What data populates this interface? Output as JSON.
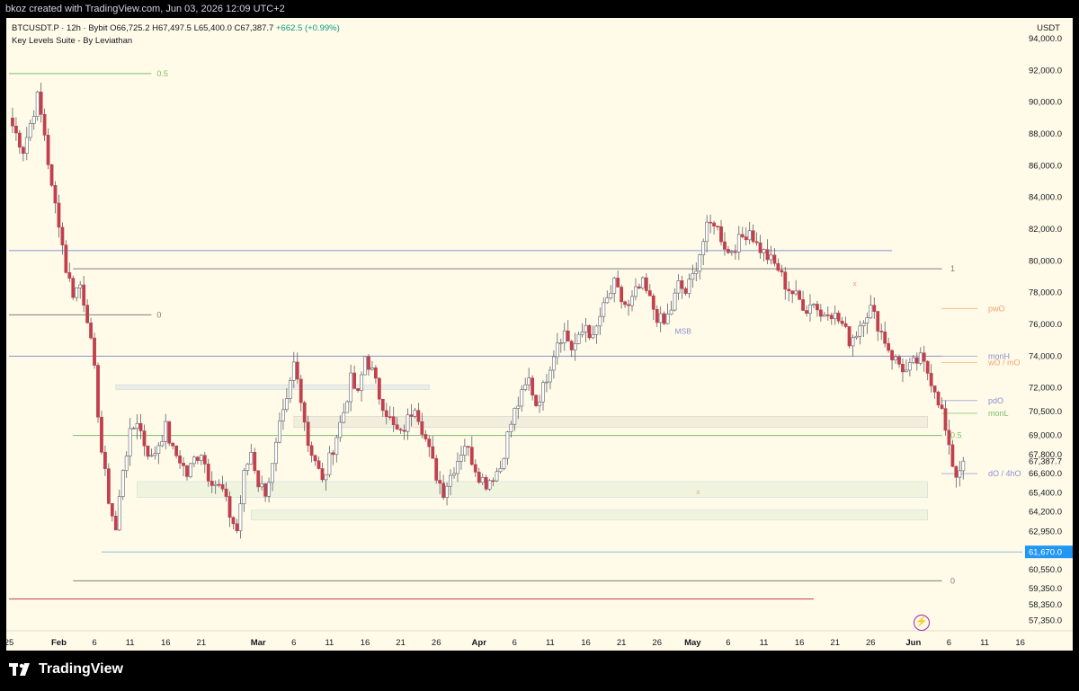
{
  "header": {
    "attribution": "bkoz created with TradingView.com, Jun 03, 2026 12:09 UTC+2"
  },
  "legend": {
    "symbol": "BTCUSDT.P · 12h · Bybit",
    "ohlc": "O66,725.2 H67,497.5 L65,400.0 C67,387.7",
    "change": "+662.5 (+0.99%)",
    "indicator": "Key Levels Suite - By Leviathan"
  },
  "brand": {
    "name": "TradingView",
    "icon": "tradingview-logo-icon"
  },
  "colors": {
    "background": "#fffbe8",
    "up": "#ffffff",
    "down": "#c2404e",
    "wick": "#5d606b",
    "blue_level": "#8c8fd6",
    "grey_level": "#7e7e7e",
    "green_level": "#7cbf6a",
    "orange_level": "#f2a272",
    "last_price_tag": "#2196f3"
  },
  "chart_data": {
    "type": "candlestick",
    "symbol": "BTCUSDT.P",
    "timeframe": "12h",
    "exchange": "Bybit",
    "ylabel": "USDT",
    "ylim": [
      56650,
      95000
    ],
    "price_ticks": [
      "94,000.0",
      "92,000.0",
      "90,000.0",
      "88,000.0",
      "86,000.0",
      "84,000.0",
      "82,000.0",
      "80,000.0",
      "78,000.0",
      "76,000.0",
      "74,000.0",
      "72,000.0",
      "70,500.0",
      "69,000.0",
      "67,800.0",
      "66,600.0",
      "65,400.0",
      "64,200.0",
      "62,950.0",
      "60,550.0",
      "59,350.0",
      "58,350.0",
      "57,350.0"
    ],
    "price_labels": [
      {
        "label": "67,387.7",
        "value": 67387.7,
        "kind": "current"
      },
      {
        "label": "61,670.0",
        "value": 61670,
        "kind": "highlight"
      }
    ],
    "x_ticks": [
      {
        "label": "25",
        "day": 0
      },
      {
        "label": "Feb",
        "day": 7,
        "bold": true
      },
      {
        "label": "6",
        "day": 12
      },
      {
        "label": "11",
        "day": 17
      },
      {
        "label": "16",
        "day": 22
      },
      {
        "label": "21",
        "day": 27
      },
      {
        "label": "Mar",
        "day": 35,
        "bold": true
      },
      {
        "label": "6",
        "day": 40
      },
      {
        "label": "11",
        "day": 45
      },
      {
        "label": "16",
        "day": 50
      },
      {
        "label": "21",
        "day": 55
      },
      {
        "label": "26",
        "day": 60
      },
      {
        "label": "Apr",
        "day": 66,
        "bold": true
      },
      {
        "label": "6",
        "day": 71
      },
      {
        "label": "11",
        "day": 76
      },
      {
        "label": "16",
        "day": 81
      },
      {
        "label": "21",
        "day": 86
      },
      {
        "label": "26",
        "day": 91
      },
      {
        "label": "May",
        "day": 96,
        "bold": true
      },
      {
        "label": "6",
        "day": 101
      },
      {
        "label": "11",
        "day": 106
      },
      {
        "label": "16",
        "day": 111
      },
      {
        "label": "21",
        "day": 116
      },
      {
        "label": "26",
        "day": 121
      },
      {
        "label": "Jun",
        "day": 127,
        "bold": true
      },
      {
        "label": "6",
        "day": 132
      },
      {
        "label": "11",
        "day": 137
      },
      {
        "label": "16",
        "day": 142
      }
    ],
    "candle_path": [
      [
        0,
        89000
      ],
      [
        2,
        87000
      ],
      [
        4,
        90300
      ],
      [
        5,
        88000
      ],
      [
        6,
        84500
      ],
      [
        7,
        82500
      ],
      [
        8,
        79500
      ],
      [
        9,
        78000
      ],
      [
        10,
        78500
      ],
      [
        11,
        76500
      ],
      [
        12,
        73000
      ],
      [
        13,
        68000
      ],
      [
        14,
        65000
      ],
      [
        15,
        63000
      ],
      [
        16,
        67000
      ],
      [
        17,
        69000
      ],
      [
        18,
        70000
      ],
      [
        19,
        68500
      ],
      [
        20,
        67500
      ],
      [
        21,
        68500
      ],
      [
        22,
        69500
      ],
      [
        23,
        68000
      ],
      [
        24,
        67500
      ],
      [
        25,
        66500
      ],
      [
        26,
        67500
      ],
      [
        27,
        68000
      ],
      [
        28,
        66500
      ],
      [
        30,
        65500
      ],
      [
        31,
        64000
      ],
      [
        32,
        63000
      ],
      [
        33,
        66500
      ],
      [
        34,
        68000
      ],
      [
        35,
        66000
      ],
      [
        36,
        65500
      ],
      [
        37,
        67000
      ],
      [
        38,
        69500
      ],
      [
        39,
        71000
      ],
      [
        40,
        73500
      ],
      [
        41,
        71500
      ],
      [
        42,
        68500
      ],
      [
        43,
        67500
      ],
      [
        44,
        66000
      ],
      [
        45,
        67500
      ],
      [
        46,
        69000
      ],
      [
        47,
        70500
      ],
      [
        48,
        72500
      ],
      [
        49,
        71500
      ],
      [
        50,
        74000
      ],
      [
        51,
        73000
      ],
      [
        52,
        71500
      ],
      [
        53,
        70500
      ],
      [
        54,
        69500
      ],
      [
        55,
        69000
      ],
      [
        56,
        70000
      ],
      [
        57,
        71000
      ],
      [
        58,
        69500
      ],
      [
        59,
        68000
      ],
      [
        60,
        66500
      ],
      [
        61,
        65500
      ],
      [
        62,
        66500
      ],
      [
        63,
        67500
      ],
      [
        64,
        68500
      ],
      [
        65,
        67500
      ],
      [
        66,
        66500
      ],
      [
        67,
        66000
      ],
      [
        68,
        66500
      ],
      [
        69,
        67000
      ],
      [
        70,
        69000
      ],
      [
        71,
        70500
      ],
      [
        72,
        71500
      ],
      [
        73,
        72500
      ],
      [
        74,
        71000
      ],
      [
        75,
        72000
      ],
      [
        76,
        73500
      ],
      [
        77,
        75000
      ],
      [
        78,
        75500
      ],
      [
        79,
        74500
      ],
      [
        80,
        75000
      ],
      [
        81,
        76000
      ],
      [
        82,
        75000
      ],
      [
        83,
        76500
      ],
      [
        84,
        77500
      ],
      [
        85,
        78500
      ],
      [
        86,
        77500
      ],
      [
        87,
        77000
      ],
      [
        88,
        78000
      ],
      [
        89,
        78500
      ],
      [
        90,
        77500
      ],
      [
        91,
        76500
      ],
      [
        92,
        76000
      ],
      [
        93,
        77000
      ],
      [
        94,
        78500
      ],
      [
        95,
        78000
      ],
      [
        96,
        79000
      ],
      [
        97,
        80500
      ],
      [
        98,
        82000
      ],
      [
        99,
        82500
      ],
      [
        100,
        81500
      ],
      [
        101,
        80500
      ],
      [
        102,
        81000
      ],
      [
        103,
        81500
      ],
      [
        104,
        82000
      ],
      [
        105,
        81000
      ],
      [
        106,
        80500
      ],
      [
        107,
        80000
      ],
      [
        108,
        79500
      ],
      [
        109,
        78500
      ],
      [
        110,
        78000
      ],
      [
        111,
        77500
      ],
      [
        112,
        77000
      ],
      [
        113,
        77500
      ],
      [
        114,
        76500
      ],
      [
        115,
        77000
      ],
      [
        116,
        76500
      ],
      [
        117,
        76000
      ],
      [
        118,
        75000
      ],
      [
        119,
        75500
      ],
      [
        120,
        76500
      ],
      [
        121,
        77000
      ],
      [
        122,
        76000
      ],
      [
        123,
        75000
      ],
      [
        124,
        74000
      ],
      [
        125,
        73500
      ],
      [
        126,
        73000
      ],
      [
        127,
        73500
      ],
      [
        128,
        73800
      ],
      [
        129,
        73000
      ],
      [
        130,
        72000
      ],
      [
        131,
        70500
      ],
      [
        132,
        68000
      ],
      [
        133,
        66500
      ],
      [
        134,
        67387.7
      ]
    ],
    "levels": [
      {
        "label": "0.5",
        "value": 91800,
        "color": "green",
        "x_from": 0,
        "x_to": 20,
        "label_at": "end"
      },
      {
        "label": "",
        "value": 80650,
        "color": "blue",
        "x_from": 0,
        "x_to": 124
      },
      {
        "label": "1",
        "value": 79500,
        "color": "grey",
        "x_from": 9,
        "x_to": 131,
        "label_at": "right"
      },
      {
        "label": "0",
        "value": 76600,
        "color": "grey",
        "x_from": 0,
        "x_to": 20,
        "label_at": "end"
      },
      {
        "label": "",
        "value": 74000,
        "color": "blue",
        "x_from": 0,
        "x_to": 131
      },
      {
        "label": "0.5",
        "value": 69000,
        "color": "green",
        "x_from": 9,
        "x_to": 131,
        "label_at": "right"
      },
      {
        "label": "",
        "value": 61670,
        "color": "lightblue",
        "x_from": 13,
        "x_to": 146
      },
      {
        "label": "0",
        "value": 59850,
        "color": "grey",
        "x_from": 9,
        "x_to": 131,
        "label_at": "right"
      },
      {
        "label": "",
        "value": 58700,
        "color": "red",
        "x_from": 0,
        "x_to": 113
      }
    ],
    "right_labels": [
      {
        "label": "pwO",
        "value": 77000,
        "color": "orange"
      },
      {
        "label": "monH",
        "value": 74000,
        "color": "blue"
      },
      {
        "label": "wO / mO",
        "value": 73600,
        "color": "orange"
      },
      {
        "label": "pdO",
        "value": 71200,
        "color": "blue"
      },
      {
        "label": "monL",
        "value": 70400,
        "color": "green"
      },
      {
        "label": "dO / 4hO",
        "value": 66600,
        "color": "blue"
      }
    ],
    "zones": [
      {
        "from": 71900,
        "to": 72200,
        "x_from": 15,
        "x_to": 59,
        "color": "blue"
      },
      {
        "from": 69500,
        "to": 70200,
        "x_from": 40,
        "x_to": 129,
        "color": "grey"
      },
      {
        "from": 65100,
        "to": 66100,
        "x_from": 18,
        "x_to": 129,
        "color": "green"
      },
      {
        "from": 63700,
        "to": 64300,
        "x_from": 34,
        "x_to": 129,
        "color": "green"
      }
    ],
    "annotations": [
      {
        "label": "MSB",
        "x": 93.5,
        "value": 75400,
        "color": "blue"
      },
      {
        "label": "x",
        "x": 118.5,
        "value": 78400,
        "color": "orange"
      },
      {
        "label": "x",
        "x": 96.5,
        "value": 65300,
        "color": "orange"
      }
    ]
  }
}
